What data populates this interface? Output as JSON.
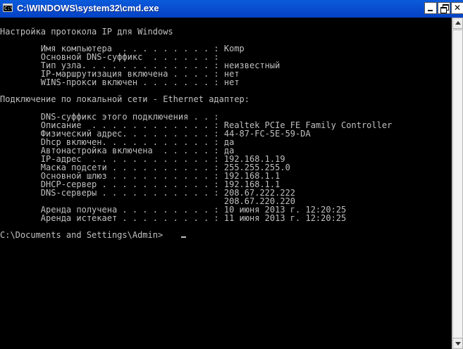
{
  "window": {
    "title": "C:\\WINDOWS\\system32\\cmd.exe",
    "icon_text": "C:\\",
    "icon": "cmd-console-icon",
    "controls": {
      "minimize": "minimize-icon",
      "maximize": "restore-icon",
      "close": "✕"
    }
  },
  "console": {
    "text_color": "#c0c0c0",
    "background": "#000000",
    "lines": [
      "Настройка протокола IP для Windows",
      "",
      "        Имя компьютера  . . . . . . . . . : Komp",
      "        Основной DNS-суффикс  . . . . . . :",
      "        Тип узла. . . . . . . . . . . . . : неизвестный",
      "        IP-маршрутизация включена . . . . : нет",
      "        WINS-прокси включен . . . . . . . : нет",
      "",
      "Подключение по локальной сети - Ethernet адаптер:",
      "",
      "        DNS-суффикс этого подключения . . :",
      "        Описание  . . . . . . . . . . . . : Realtek PCIe FE Family Controller",
      "        Физический адрес. . . . . . . . . : 44-87-FC-5E-59-DA",
      "        Dhcp включен. . . . . . . . . . . : да",
      "        Автонастройка включена  . . . . . : да",
      "        IP-адрес  . . . . . . . . . . . . : 192.168.1.19",
      "        Маска подсети . . . . . . . . . . : 255.255.255.0",
      "        Основной шлюз . . . . . . . . . . : 192.168.1.1",
      "        DHCP-сервер . . . . . . . . . . . : 192.168.1.1",
      "        DNS-серверы . . . . . . . . . . . : 208.67.222.222",
      "                                            208.67.220.220",
      "        Аренда получена . . . . . . . . . : 10 июня 2013 г. 12:20:25",
      "        Аренда истекает . . . . . . . . . : 11 июня 2013 г. 12:20:25",
      "",
      "C:\\Documents and Settings\\Admin>"
    ]
  }
}
